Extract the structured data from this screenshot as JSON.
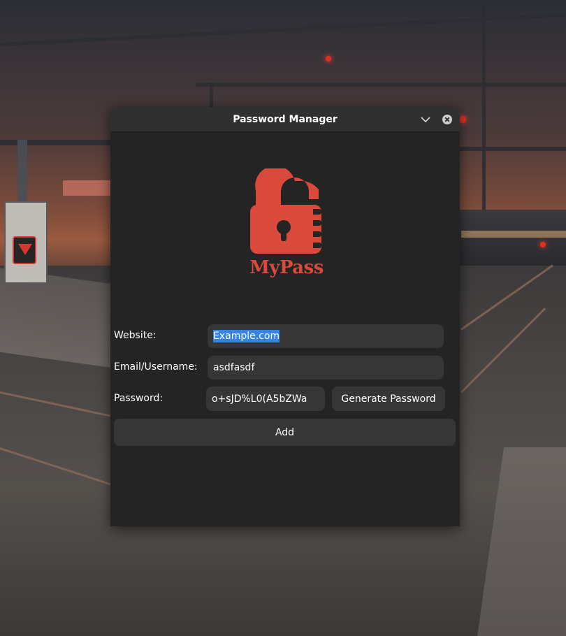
{
  "window": {
    "title": "Password Manager"
  },
  "logo": {
    "text": "MyPass",
    "color": "#d94a3c"
  },
  "form": {
    "website_label": "Website:",
    "website_value": "Example.com",
    "email_label": "Email/Username:",
    "email_value": "asdfasdf",
    "password_label": "Password:",
    "password_value": "o+sJD%L0(A5bZWa",
    "generate_button": "Generate Password",
    "add_button": "Add"
  },
  "colors": {
    "window_bg": "#242424",
    "titlebar_bg": "#303030",
    "field_bg": "#363636",
    "selection": "#3584e4"
  },
  "icons": {
    "minimize": "chevron-down-icon",
    "close": "close-icon",
    "logo": "padlock-icon"
  }
}
